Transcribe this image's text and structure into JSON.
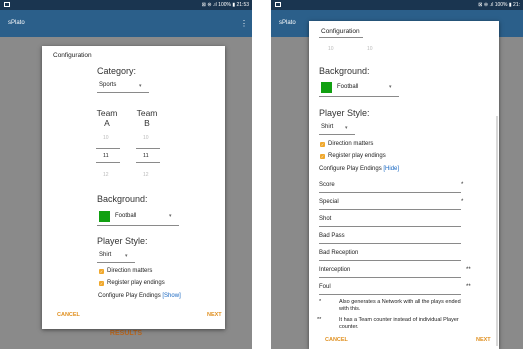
{
  "status_bar": {
    "right_text_left": "⊠ ⊜ .ıl 100% ▮ 21:53",
    "right_text_right": "⊠ ⊜ .ıl 100% ▮ 21:"
  },
  "app": {
    "title": "sPlato",
    "overflow_menu": "⋮",
    "results_label": "RESULTS"
  },
  "left_dialog": {
    "title": "Configuration",
    "category_label": "Category:",
    "category_value": "Sports",
    "team_a_label": "Team\nA",
    "team_b_label": "Team\nB",
    "team_a_picker": {
      "prev": "10",
      "current": "11",
      "next": "12"
    },
    "team_b_picker": {
      "prev": "10",
      "current": "11",
      "next": "12"
    },
    "background_label": "Background:",
    "background_value": "Football",
    "player_style_label": "Player Style:",
    "player_style_value": "Shirt",
    "direction_matters": "Direction matters",
    "register_play_endings": "Register play endings",
    "configure_play_endings": "Configure Play Endings",
    "show_link": "[Show]",
    "cancel": "CANCEL",
    "next": "NEXT"
  },
  "right_dialog": {
    "title": "Configuration",
    "picker_a_prev": "10",
    "picker_b_prev": "10",
    "background_label": "Background:",
    "background_value": "Football",
    "player_style_label": "Player Style:",
    "player_style_value": "Shirt",
    "direction_matters": "Direction matters",
    "register_play_endings": "Register play endings",
    "configure_play_endings": "Configure Play Endings",
    "hide_link": "[Hide]",
    "endings": [
      {
        "value": "Score",
        "mark": "*"
      },
      {
        "value": "Special",
        "mark": "*"
      },
      {
        "value": "Shot",
        "mark": ""
      },
      {
        "value": "Bad Pass",
        "mark": ""
      },
      {
        "value": "Bad Reception",
        "mark": ""
      },
      {
        "value": "Interception",
        "mark": "**"
      },
      {
        "value": "Foul",
        "mark": "**"
      }
    ],
    "footnotes": [
      {
        "mark": "*",
        "text_line1": "Also generates a Network with all the plays ended",
        "text_line2": "with this."
      },
      {
        "mark": "**",
        "text_line1": "It has a Team counter instead of individual Player",
        "text_line2": "counter."
      }
    ],
    "cancel": "CANCEL",
    "next": "NEXT"
  },
  "colors": {
    "accent": "#e09020",
    "app_bar": "#2b5f8a",
    "status_bar": "#1a3550",
    "swatch": "#11a011",
    "link": "#1565c0"
  },
  "icons": {
    "checkbox": "checkbox-checked-icon",
    "dropdown": "dropdown-caret-icon",
    "overflow": "overflow-menu-icon"
  }
}
